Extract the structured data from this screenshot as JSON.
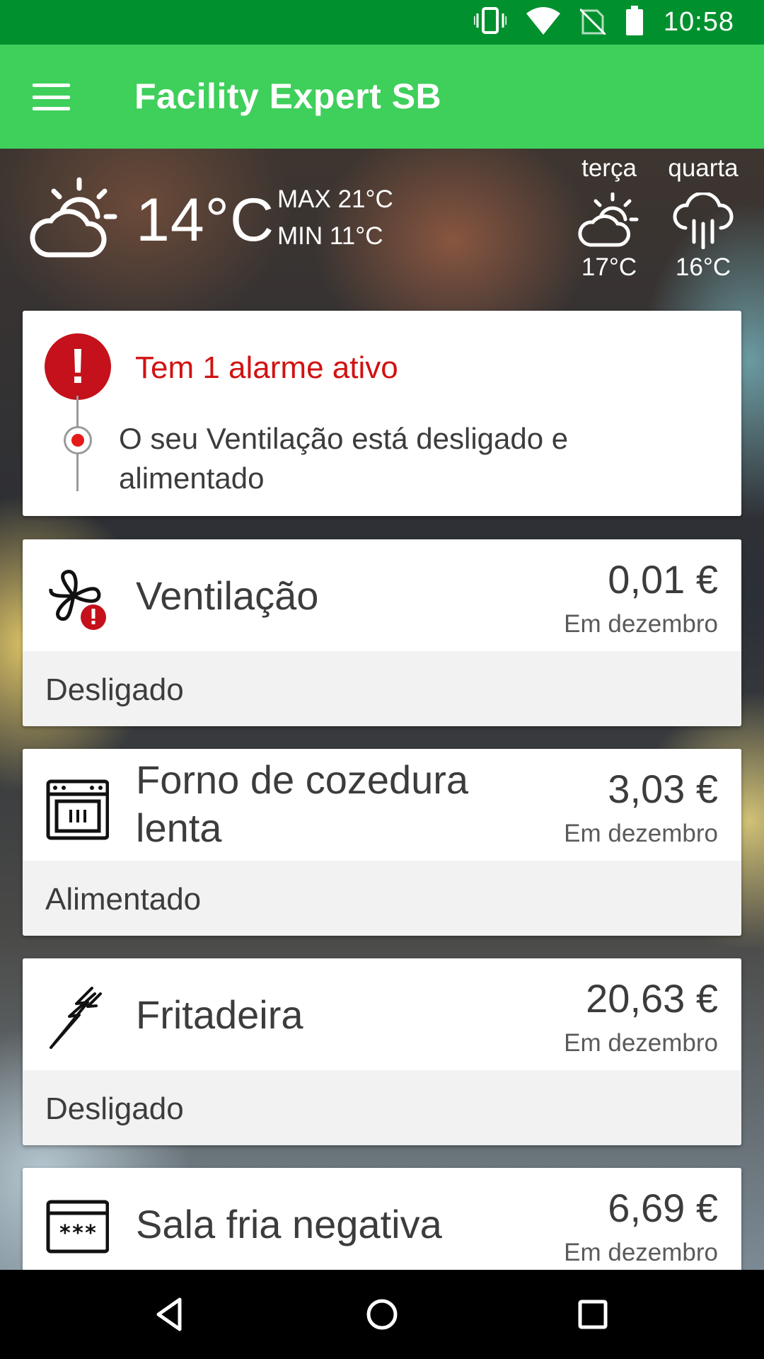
{
  "status_bar": {
    "time": "10:58",
    "icons": [
      "vibrate-icon",
      "wifi-icon",
      "no-sim-icon",
      "battery-icon"
    ]
  },
  "app_bar": {
    "title": "Facility Expert SB",
    "menu_icon": "menu-icon"
  },
  "weather": {
    "current_temp": "14°C",
    "max": "MAX 21°C",
    "min": "MIN 11°C",
    "current_icon": "partly-cloudy-icon",
    "forecast": [
      {
        "day": "terça",
        "temp": "17°C",
        "icon": "partly-cloudy-icon"
      },
      {
        "day": "quarta",
        "temp": "16°C",
        "icon": "rain-icon"
      }
    ]
  },
  "alarm": {
    "title": "Tem 1 alarme ativo",
    "message": "O seu Ventilação está desligado e alimentado",
    "accent": "#c4111b"
  },
  "devices": [
    {
      "name": "Ventilação",
      "price": "0,01 €",
      "period": "Em dezembro",
      "status": "Desligado",
      "icon": "fan-alert-icon"
    },
    {
      "name": "Forno de cozedura lenta",
      "price": "3,03 €",
      "period": "Em dezembro",
      "status": "Alimentado",
      "icon": "oven-icon"
    },
    {
      "name": "Fritadeira",
      "price": "20,63 €",
      "period": "Em dezembro",
      "status": "Desligado",
      "icon": "lightning-icon"
    },
    {
      "name": "Sala fria negativa",
      "price": "6,69 €",
      "period": "Em dezembro",
      "status": "",
      "icon": "cold-room-icon"
    }
  ],
  "colors": {
    "status_bar": "#00912e",
    "app_bar": "#3fcf5b",
    "alarm_red": "#d11212"
  }
}
